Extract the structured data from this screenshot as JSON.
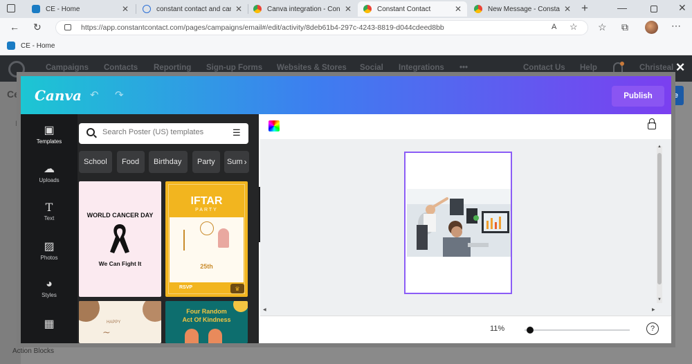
{
  "browser": {
    "tabs": [
      {
        "title": "CE - Home",
        "active": false,
        "favicon": "constant-contact-favicon"
      },
      {
        "title": "constant contact and canva",
        "active": false,
        "favicon": "search-favicon"
      },
      {
        "title": "Canva integration - Const",
        "active": false,
        "favicon": "chrome-favicon"
      },
      {
        "title": "Constant Contact",
        "active": true,
        "favicon": "chrome-favicon"
      },
      {
        "title": "New Message - Constant",
        "active": false,
        "favicon": "chrome-favicon"
      }
    ],
    "url": "https://app.constantcontact.com/pages/campaigns/email#/edit/activity/8deb61b4-297c-4243-8819-d044cdeed8bb",
    "reader_label": "A",
    "favorites": [
      {
        "label": "CE - Home"
      }
    ]
  },
  "site": {
    "nav": [
      "Campaigns",
      "Contacts",
      "Reporting",
      "Sign-up Forms",
      "Websites & Stores",
      "Social",
      "Integrations",
      "•••",
      "Contact Us",
      "Help",
      "Christeal"
    ],
    "left_letters": [
      "Ce",
      "E"
    ],
    "action_blocks_label": "Action Blocks"
  },
  "canva": {
    "logo": "Canva",
    "publish_label": "Publish",
    "rail": [
      {
        "label": "Templates",
        "icon": "templates-icon",
        "active": true
      },
      {
        "label": "Uploads",
        "icon": "upload-cloud-icon",
        "active": false
      },
      {
        "label": "Text",
        "icon": "text-icon",
        "active": false
      },
      {
        "label": "Photos",
        "icon": "photos-icon",
        "active": false
      },
      {
        "label": "Styles",
        "icon": "palette-icon",
        "active": false
      }
    ],
    "search_placeholder": "Search Poster (US) templates",
    "chips": [
      "School",
      "Food",
      "Birthday",
      "Party",
      "Sum"
    ],
    "templates": [
      {
        "title_lines": [
          "WORLD CANCER DAY",
          "We Can Fight It"
        ],
        "bg": "#fbeaf0"
      },
      {
        "title_lines": [
          "IFTAR",
          "PARTY",
          "25th",
          "RSVP"
        ],
        "bg": "#f2b51f"
      },
      {
        "title_lines": [
          "HAPPY"
        ],
        "bg": "#f7efe2"
      },
      {
        "title_lines": [
          "Four Random",
          "Act Of Kindness"
        ],
        "bg": "#0d6e6e"
      }
    ],
    "zoom": "11%",
    "zoom_fraction": 0.05,
    "help": "?"
  }
}
